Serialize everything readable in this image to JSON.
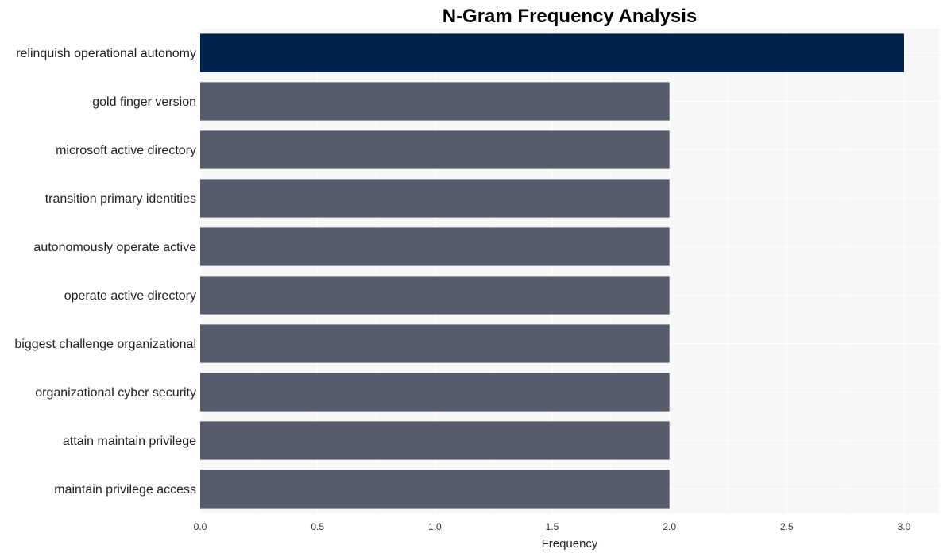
{
  "chart_data": {
    "type": "bar",
    "orientation": "horizontal",
    "title": "N-Gram Frequency Analysis",
    "xlabel": "Frequency",
    "ylabel": "",
    "xlim": [
      0,
      3.15
    ],
    "xticks": [
      0.0,
      0.5,
      1.0,
      1.5,
      2.0,
      2.5,
      3.0
    ],
    "xtick_labels": [
      "0.0",
      "0.5",
      "1.0",
      "1.5",
      "2.0",
      "2.5",
      "3.0"
    ],
    "grid": true,
    "legend": "none",
    "categories": [
      "relinquish operational autonomy",
      "gold finger version",
      "microsoft active directory",
      "transition primary identities",
      "autonomously operate active",
      "operate active directory",
      "biggest challenge organizational",
      "organizational cyber security",
      "attain maintain privilege",
      "maintain privilege access"
    ],
    "values": [
      3,
      2,
      2,
      2,
      2,
      2,
      2,
      2,
      2,
      2
    ],
    "colors": {
      "highlight": "#00224e",
      "default": "#575c6d",
      "plot_background": "#f7f7f7",
      "grid": "#ffffff"
    }
  }
}
